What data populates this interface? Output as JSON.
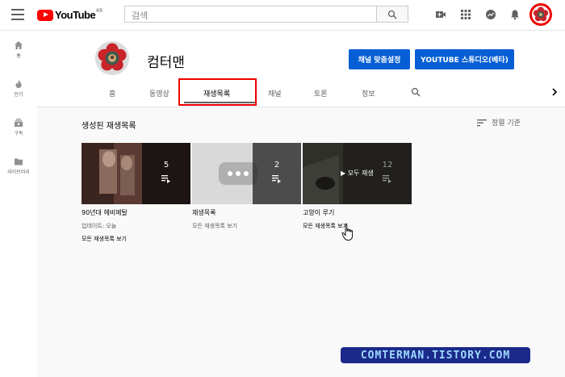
{
  "topbar": {
    "logo_text": "YouTube",
    "logo_region": "KR",
    "search_placeholder": "검색"
  },
  "sidebar": {
    "items": [
      {
        "label": "홈",
        "icon": "home-icon"
      },
      {
        "label": "인기",
        "icon": "fire-icon"
      },
      {
        "label": "구독",
        "icon": "subscriptions-icon"
      },
      {
        "label": "라이브러리",
        "icon": "folder-icon"
      }
    ]
  },
  "channel": {
    "name": "컴터맨",
    "customize_button": "채널 맞춤설정",
    "studio_button": "YOUTUBE 스튜디오(베타)",
    "tabs": [
      "홈",
      "동영상",
      "재생목록",
      "채널",
      "토론",
      "정보"
    ],
    "active_tab": "재생목록"
  },
  "section": {
    "title": "생성된 재생목록",
    "sort_label": "정렬 기준"
  },
  "playlists": [
    {
      "title": "90년대 헤비메탈",
      "count": "5",
      "updated": "업데이트: 오늘",
      "link": "모든 재생목록 보기"
    },
    {
      "title": "재생목록",
      "count": "2",
      "updated": "",
      "link": "모든 재생목록 보기"
    },
    {
      "title": "고양이 루기",
      "count": "12",
      "hover_label": "▶ 모두 재생",
      "updated": "",
      "link": "모든 재생목록 보기"
    }
  ],
  "watermark": "COMTERMAN.TISTORY.COM",
  "colors": {
    "accent": "#065fd4",
    "brand": "#ff0000",
    "highlight": "#e00000"
  }
}
